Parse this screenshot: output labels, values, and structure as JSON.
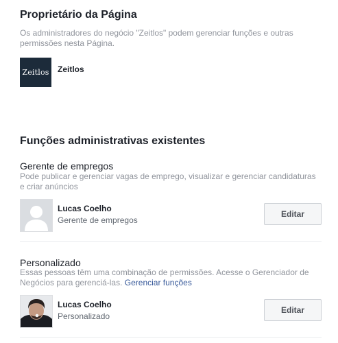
{
  "owner": {
    "title": "Proprietário da Página",
    "description": "Os administradores do negócio \"Zeitlos\" podem gerenciar funções e outras permissões nesta Página.",
    "logo_text": "Zeitlos",
    "name": "Zeitlos"
  },
  "roles": {
    "title": "Funções administrativas existentes",
    "groups": [
      {
        "title": "Gerente de empregos",
        "description": "Pode publicar e gerenciar vagas de emprego, visualizar e gerenciar candidaturas e criar anúncios",
        "person_name": "Lucas Coelho",
        "person_role": "Gerente de empregos",
        "edit_label": "Editar"
      },
      {
        "title": "Personalizado",
        "description": "Essas pessoas têm uma combinação de permissões. Acesse o Gerenciador de Negócios para gerenciá-las.",
        "link_label": "Gerenciar funções",
        "person_name": "Lucas Coelho",
        "person_role": "Personalizado",
        "edit_label": "Editar"
      }
    ]
  }
}
